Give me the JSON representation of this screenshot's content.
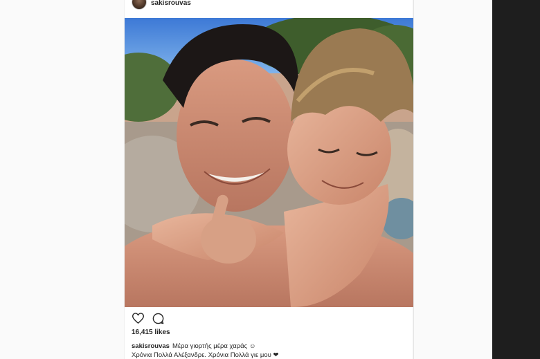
{
  "post": {
    "username": "sakisrouvas",
    "likes_count": "16,415",
    "likes_label": "likes",
    "caption_user": "sakisrouvas",
    "caption_line1": "Μέρα γιορτής μέρα χαράς ☺",
    "caption_line2": "Χρόνια Πολλά Αλέξανδρε. Χρόνια Πολλά γιε μου ❤"
  },
  "icons": {
    "like": "heart-icon",
    "comment": "comment-icon"
  },
  "colors": {
    "text": "#262626",
    "dark_bar": "#1e1e1e"
  }
}
